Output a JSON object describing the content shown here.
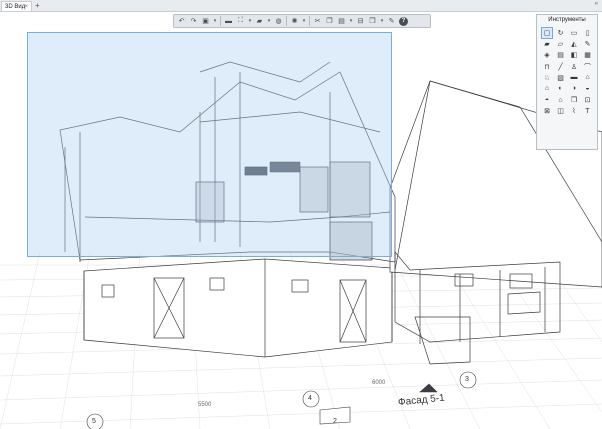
{
  "tabs": [
    {
      "label": "3D Вид",
      "close": "×"
    }
  ],
  "tab_add": "+",
  "tab_scroll": "»",
  "toolbar": {
    "buttons": [
      {
        "name": "undo-icon",
        "glyph": "↶"
      },
      {
        "name": "redo-icon",
        "glyph": "↷"
      },
      {
        "name": "layers-icon",
        "glyph": "▣"
      },
      {
        "name": "layers-caret",
        "glyph": "▾"
      },
      {
        "name": "separator",
        "glyph": ""
      },
      {
        "name": "folder-icon",
        "glyph": "▬"
      },
      {
        "name": "section-icon",
        "glyph": "⛶"
      },
      {
        "name": "section-caret",
        "glyph": "▾"
      },
      {
        "name": "camera-icon",
        "glyph": "▰"
      },
      {
        "name": "camera-caret",
        "glyph": "▾"
      },
      {
        "name": "render-icon",
        "glyph": "◍"
      },
      {
        "name": "separator",
        "glyph": ""
      },
      {
        "name": "sun-icon",
        "glyph": "✺"
      },
      {
        "name": "sun-caret",
        "glyph": "▾"
      },
      {
        "name": "separator",
        "glyph": ""
      },
      {
        "name": "scissors-icon",
        "glyph": "✂"
      },
      {
        "name": "copy-icon",
        "glyph": "❐"
      },
      {
        "name": "paste-icon",
        "glyph": "▤"
      },
      {
        "name": "paste-caret",
        "glyph": "▾"
      },
      {
        "name": "filter-icon",
        "glyph": "⊟"
      },
      {
        "name": "view-cube-icon",
        "glyph": "❒"
      },
      {
        "name": "view-caret",
        "glyph": "▾"
      },
      {
        "name": "wrench-icon",
        "glyph": "✎"
      },
      {
        "name": "help-icon",
        "glyph": "?"
      }
    ]
  },
  "tools_panel": {
    "title": "Инструменты",
    "tools": [
      {
        "name": "select-tool-icon",
        "glyph": "▢",
        "active": true
      },
      {
        "name": "rotate-tool-icon",
        "glyph": "↻"
      },
      {
        "name": "window-tool-icon",
        "glyph": "▭"
      },
      {
        "name": "column-tool-icon",
        "glyph": "▯"
      },
      {
        "name": "wall-tool-icon",
        "glyph": "▰"
      },
      {
        "name": "beam-tool-icon",
        "glyph": "▱"
      },
      {
        "name": "roof-tool-icon",
        "glyph": "◭"
      },
      {
        "name": "pencil-tool-icon",
        "glyph": "✎"
      },
      {
        "name": "slab-tool-icon",
        "glyph": "◈"
      },
      {
        "name": "stair-tool-icon",
        "glyph": "▤"
      },
      {
        "name": "door-tool-icon",
        "glyph": "◧"
      },
      {
        "name": "mesh-tool-icon",
        "glyph": "▦"
      },
      {
        "name": "railing-tool-icon",
        "glyph": "⊓"
      },
      {
        "name": "line-tool-icon",
        "glyph": "╱"
      },
      {
        "name": "lamp-tool-icon",
        "glyph": "♙"
      },
      {
        "name": "curtain-tool-icon",
        "glyph": "⌒"
      },
      {
        "name": "person-tool-icon",
        "glyph": "♘"
      },
      {
        "name": "grid-tool-icon",
        "glyph": "▧"
      },
      {
        "name": "label-tool-icon",
        "glyph": "▬"
      },
      {
        "name": "zone-tool-icon",
        "glyph": "⌂"
      },
      {
        "name": "room-tool-icon",
        "glyph": "⌂"
      },
      {
        "name": "morph-tool-icon",
        "glyph": "◐"
      },
      {
        "name": "shell-tool-icon",
        "glyph": "◑"
      },
      {
        "name": "object-tool-icon",
        "glyph": "◒"
      },
      {
        "name": "hatch-tool-icon",
        "glyph": "◓"
      },
      {
        "name": "house-tool-icon",
        "glyph": "⌂"
      },
      {
        "name": "cube-tool-icon",
        "glyph": "❒"
      },
      {
        "name": "measure-tool-icon",
        "glyph": "⊡"
      },
      {
        "name": "cut-tool-icon",
        "glyph": "⊠"
      },
      {
        "name": "figure-tool-icon",
        "glyph": "◫"
      },
      {
        "name": "curve-tool-icon",
        "glyph": "⌇"
      },
      {
        "name": "text-tool-icon",
        "glyph": "T"
      }
    ]
  },
  "scene_labels": {
    "grid_4": "4",
    "grid_3": "3",
    "grid_5": "5",
    "grid_2": "2",
    "dim_1": "5500",
    "dim_2": "6000",
    "facade_label": "Фасад 5-1"
  }
}
